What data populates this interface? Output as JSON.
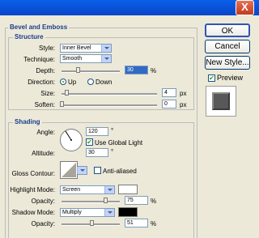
{
  "window": {
    "close_glyph": "X"
  },
  "dialog": {
    "title": "Bevel and Emboss",
    "structure": {
      "legend": "Structure",
      "style_label": "Style:",
      "style_value": "Inner Bevel",
      "technique_label": "Technique:",
      "technique_value": "Smooth",
      "depth_label": "Depth:",
      "depth_value": "30",
      "depth_unit": "%",
      "depth_level": 0.28,
      "direction_label": "Direction:",
      "direction_up": "Up",
      "direction_down": "Down",
      "direction_selected": "Up",
      "size_label": "Size:",
      "size_value": "4",
      "size_unit": "px",
      "size_level": 0.05,
      "soften_label": "Soften:",
      "soften_value": "0",
      "soften_unit": "px",
      "soften_level": 0
    },
    "shading": {
      "legend": "Shading",
      "angle_label": "Angle:",
      "angle_value": "120",
      "angle_unit": "°",
      "global_light_label": "Use Global Light",
      "global_light_checked": true,
      "altitude_label": "Altitude:",
      "altitude_value": "30",
      "altitude_unit": "°",
      "gloss_contour_label": "Gloss Contour:",
      "anti_aliased_label": "Anti-aliased",
      "anti_aliased_checked": false,
      "highlight_mode_label": "Highlight Mode:",
      "highlight_mode_value": "Screen",
      "highlight_color": "#FFFFFF",
      "highlight_opacity_label": "Opacity:",
      "highlight_opacity_value": "75",
      "highlight_opacity_unit": "%",
      "highlight_opacity_level": 0.75,
      "shadow_mode_label": "Shadow Mode:",
      "shadow_mode_value": "Multiply",
      "shadow_color": "#000000",
      "shadow_opacity_label": "Opacity:",
      "shadow_opacity_value": "51",
      "shadow_opacity_unit": "%",
      "shadow_opacity_level": 0.51
    }
  },
  "buttons": {
    "ok": "OK",
    "cancel": "Cancel",
    "new_style": "New Style...",
    "preview_label": "Preview",
    "preview_checked": true
  }
}
